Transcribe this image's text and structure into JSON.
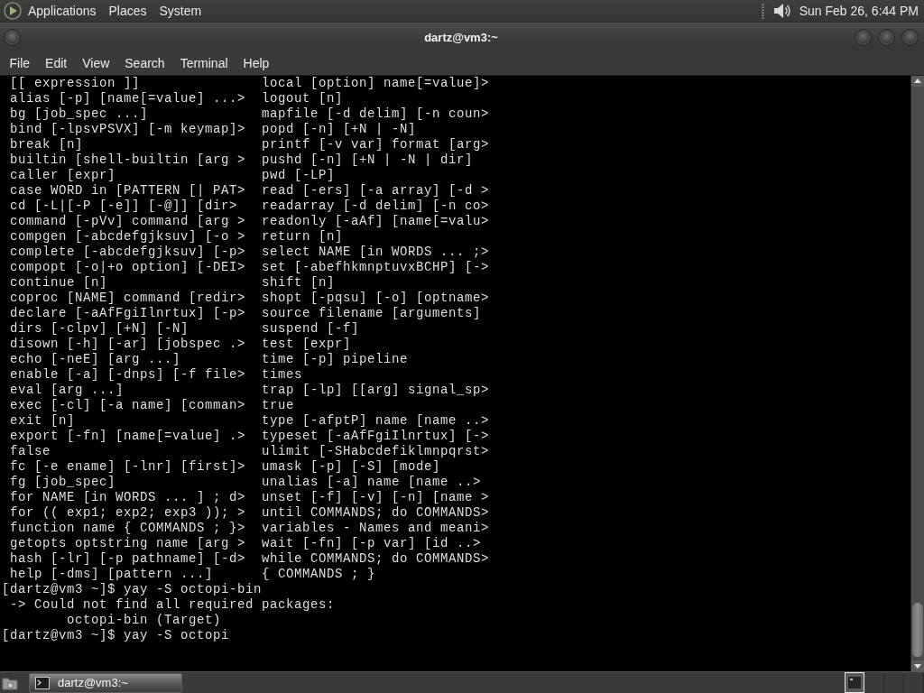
{
  "top_panel": {
    "menus": [
      "Applications",
      "Places",
      "System"
    ],
    "clock": "Sun Feb 26, 6:44 PM"
  },
  "window": {
    "title": "dartz@vm3:~"
  },
  "menu_bar": [
    "File",
    "Edit",
    "View",
    "Search",
    "Terminal",
    "Help"
  ],
  "terminal": {
    "help_rows": [
      {
        "left": "[[ expression ]]",
        "right": "local [option] name[=value]>"
      },
      {
        "left": "alias [-p] [name[=value] ...>",
        "right": "logout [n]"
      },
      {
        "left": "bg [job_spec ...]",
        "right": "mapfile [-d delim] [-n coun>"
      },
      {
        "left": "bind [-lpsvPSVX] [-m keymap]>",
        "right": "popd [-n] [+N | -N]"
      },
      {
        "left": "break [n]",
        "right": "printf [-v var] format [arg>"
      },
      {
        "left": "builtin [shell-builtin [arg >",
        "right": "pushd [-n] [+N | -N | dir]"
      },
      {
        "left": "caller [expr]",
        "right": "pwd [-LP]"
      },
      {
        "left": "case WORD in [PATTERN [| PAT>",
        "right": "read [-ers] [-a array] [-d >"
      },
      {
        "left": "cd [-L|[-P [-e]] [-@]] [dir>",
        "right": "readarray [-d delim] [-n co>"
      },
      {
        "left": "command [-pVv] command [arg >",
        "right": "readonly [-aAf] [name[=valu>"
      },
      {
        "left": "compgen [-abcdefgjksuv] [-o >",
        "right": "return [n]"
      },
      {
        "left": "complete [-abcdefgjksuv] [-p>",
        "right": "select NAME [in WORDS ... ;>"
      },
      {
        "left": "compopt [-o|+o option] [-DEI>",
        "right": "set [-abefhkmnptuvxBCHP] [->"
      },
      {
        "left": "continue [n]",
        "right": "shift [n]"
      },
      {
        "left": "coproc [NAME] command [redir>",
        "right": "shopt [-pqsu] [-o] [optname>"
      },
      {
        "left": "declare [-aAfFgiIlnrtux] [-p>",
        "right": "source filename [arguments]"
      },
      {
        "left": "dirs [-clpv] [+N] [-N]",
        "right": "suspend [-f]"
      },
      {
        "left": "disown [-h] [-ar] [jobspec .>",
        "right": "test [expr]"
      },
      {
        "left": "echo [-neE] [arg ...]",
        "right": "time [-p] pipeline"
      },
      {
        "left": "enable [-a] [-dnps] [-f file>",
        "right": "times"
      },
      {
        "left": "eval [arg ...]",
        "right": "trap [-lp] [[arg] signal_sp>"
      },
      {
        "left": "exec [-cl] [-a name] [comman>",
        "right": "true"
      },
      {
        "left": "exit [n]",
        "right": "type [-afptP] name [name ..>"
      },
      {
        "left": "export [-fn] [name[=value] .>",
        "right": "typeset [-aAfFgiIlnrtux] [->"
      },
      {
        "left": "false",
        "right": "ulimit [-SHabcdefiklmnpqrst>"
      },
      {
        "left": "fc [-e ename] [-lnr] [first]>",
        "right": "umask [-p] [-S] [mode]"
      },
      {
        "left": "fg [job_spec]",
        "right": "unalias [-a] name [name ..>"
      },
      {
        "left": "for NAME [in WORDS ... ] ; d>",
        "right": "unset [-f] [-v] [-n] [name >"
      },
      {
        "left": "for (( exp1; exp2; exp3 )); >",
        "right": "until COMMANDS; do COMMANDS>"
      },
      {
        "left": "function name { COMMANDS ; }>",
        "right": "variables - Names and meani>"
      },
      {
        "left": "getopts optstring name [arg >",
        "right": "wait [-fn] [-p var] [id ..>"
      },
      {
        "left": "hash [-lr] [-p pathname] [-d>",
        "right": "while COMMANDS; do COMMANDS>"
      },
      {
        "left": "help [-dms] [pattern ...]",
        "right": "{ COMMANDS ; }"
      }
    ],
    "lines": [
      {
        "kind": "prompt",
        "text": "[dartz@vm3 ~]$ yay -S octopi-bin"
      },
      {
        "kind": "message",
        "text": "-> Could not find all required packages:"
      },
      {
        "kind": "detail",
        "text": "octopi-bin (Target)"
      },
      {
        "kind": "prompt",
        "text": "[dartz@vm3 ~]$ yay -S octopi"
      }
    ]
  },
  "taskbar": {
    "tasks": [
      {
        "label": "dartz@vm3:~",
        "selected": true
      }
    ],
    "workspaces": [
      {
        "selected": true
      },
      {
        "selected": false
      },
      {
        "selected": false
      },
      {
        "selected": false
      }
    ]
  }
}
